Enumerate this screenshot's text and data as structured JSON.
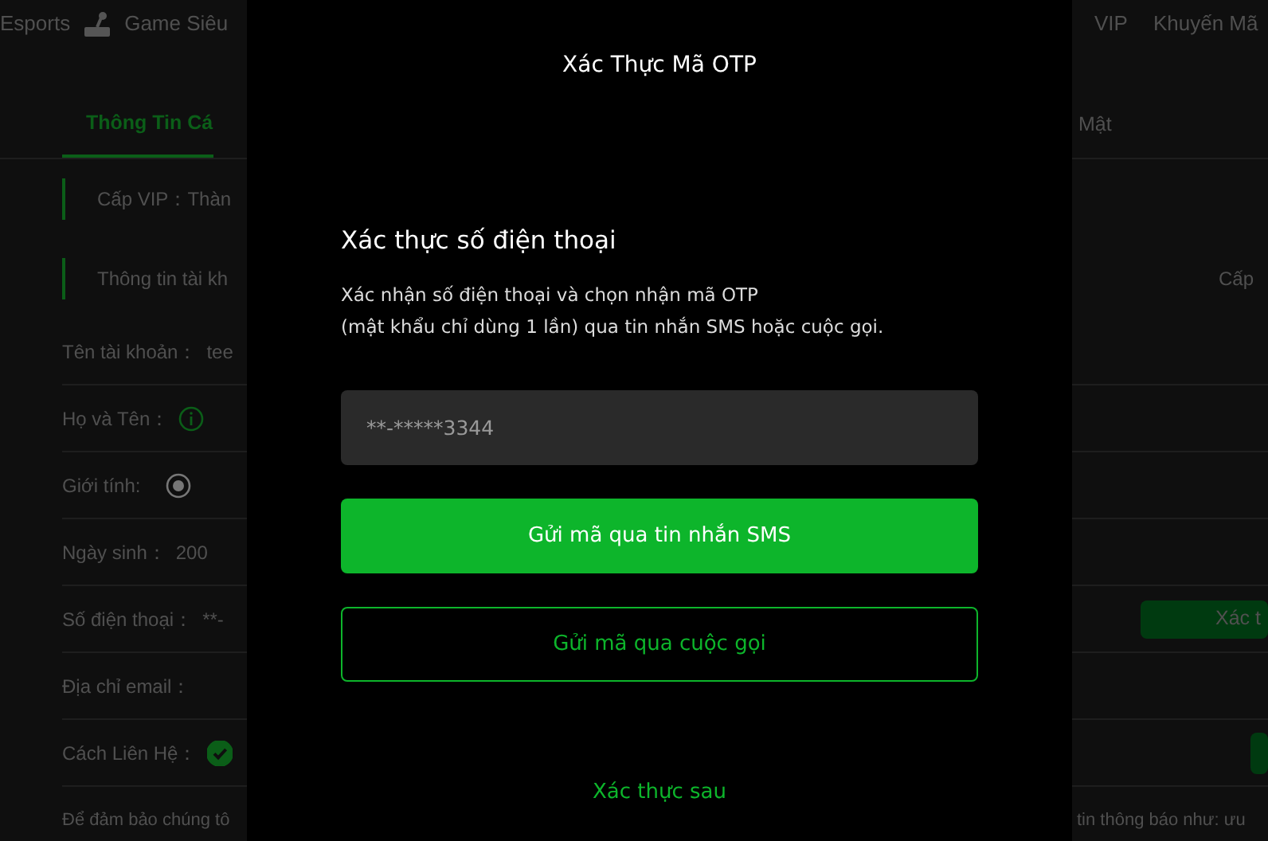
{
  "nav": {
    "left": [
      "Esports",
      "Game Siêu"
    ],
    "right": [
      "VIP",
      "Khuyến Mã"
    ]
  },
  "profile_tabs": [
    {
      "label": "Thông Tin Cá",
      "selected": true
    },
    {
      "label": "Mật",
      "selected": false
    }
  ],
  "profile_rows": [
    {
      "kind": "section",
      "label": "Cấp VIP：Thàn"
    },
    {
      "kind": "section",
      "label": "Thông tin tài kh",
      "right_text": "Cấp"
    },
    {
      "kind": "field",
      "label": "Tên tài khoản：",
      "value": "tee"
    },
    {
      "kind": "info",
      "label": "Họ và Tên："
    },
    {
      "kind": "radio",
      "label": "Giới tính:",
      "checked": true
    },
    {
      "kind": "field",
      "label": "Ngày sinh：",
      "value": "200"
    },
    {
      "kind": "field",
      "label": "Số điện thoại：",
      "value": "**-",
      "right_button": "Xác t"
    },
    {
      "kind": "field",
      "label": "Địa chỉ email："
    },
    {
      "kind": "check",
      "label": "Cách Liên Hệ：",
      "checked": true,
      "right_button": ""
    },
    {
      "kind": "note",
      "label": "Để đảm bảo chúng tô",
      "right_text": "tin thông báo như: ưu"
    }
  ],
  "modal": {
    "title": "Xác Thực Mã OTP",
    "heading": "Xác thực số điện thoại",
    "description": [
      "Xác nhận số điện thoại và chọn nhận mã OTP",
      "(mật khẩu chỉ dùng 1 lần) qua tin nhắn SMS hoặc cuộc gọi."
    ],
    "phone": "**-*****3344",
    "buttons": [
      {
        "kind": "primary",
        "label": "Gửi mã qua tin nhắn SMS"
      },
      {
        "kind": "outline",
        "label": "Gửi mã qua cuộc gọi"
      }
    ],
    "later_link": "Xác thực sau"
  }
}
